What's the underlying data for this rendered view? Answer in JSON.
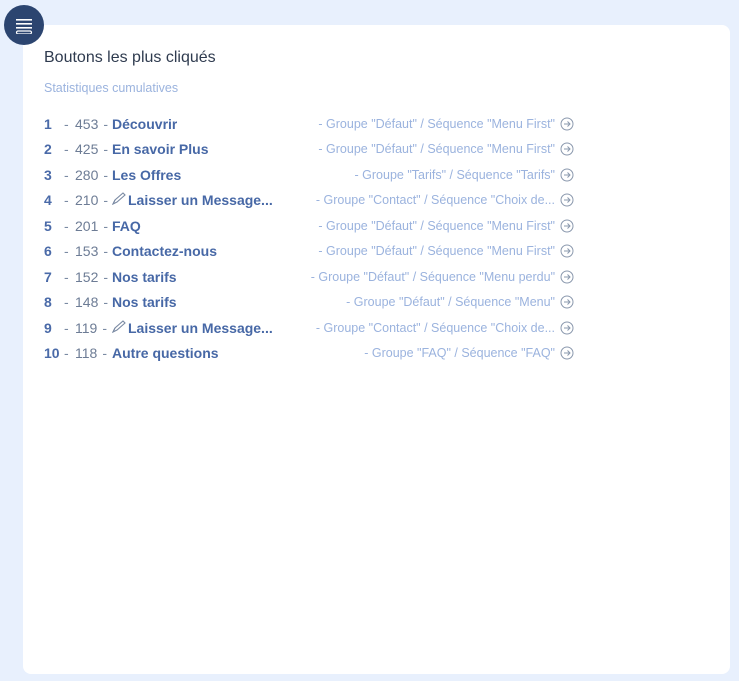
{
  "header": {
    "title": "Boutons les plus cliqués",
    "subtitle": "Statistiques cumulatives"
  },
  "separator": "-",
  "rows": [
    {
      "rank": "1",
      "count": "453",
      "label": "Découvrir",
      "has_pencil": false,
      "group": "- Groupe \"Défaut\" / Séquence \"Menu First\""
    },
    {
      "rank": "2",
      "count": "425",
      "label": "En savoir Plus",
      "has_pencil": false,
      "group": "- Groupe \"Défaut\" / Séquence \"Menu First\""
    },
    {
      "rank": "3",
      "count": "280",
      "label": "Les Offres",
      "has_pencil": false,
      "group": "- Groupe \"Tarifs\" / Séquence \"Tarifs\""
    },
    {
      "rank": "4",
      "count": "210",
      "label": "Laisser un Message...",
      "has_pencil": true,
      "group": "- Groupe \"Contact\" / Séquence \"Choix de..."
    },
    {
      "rank": "5",
      "count": "201",
      "label": "FAQ",
      "has_pencil": false,
      "group": "- Groupe \"Défaut\" / Séquence \"Menu First\""
    },
    {
      "rank": "6",
      "count": "153",
      "label": "Contactez-nous",
      "has_pencil": false,
      "group": "- Groupe \"Défaut\" / Séquence \"Menu First\""
    },
    {
      "rank": "7",
      "count": "152",
      "label": "Nos tarifs",
      "has_pencil": false,
      "group": "- Groupe \"Défaut\" / Séquence \"Menu perdu\""
    },
    {
      "rank": "8",
      "count": "148",
      "label": "Nos tarifs",
      "has_pencil": false,
      "group": "- Groupe \"Défaut\" / Séquence \"Menu\""
    },
    {
      "rank": "9",
      "count": "119",
      "label": "Laisser un Message...",
      "has_pencil": true,
      "group": "- Groupe \"Contact\" / Séquence \"Choix de..."
    },
    {
      "rank": "10",
      "count": "118",
      "label": "Autre questions",
      "has_pencil": false,
      "group": "- Groupe \"FAQ\" / Séquence \"FAQ\""
    }
  ],
  "icons": {
    "menu": "menu-icon",
    "pencil": "pencil-icon",
    "arrow": "arrow-right-circle-icon"
  },
  "colors": {
    "background": "#e8f0fd",
    "menu_button": "#2c4570",
    "label": "#4768a6",
    "muted": "#9bb3de"
  }
}
